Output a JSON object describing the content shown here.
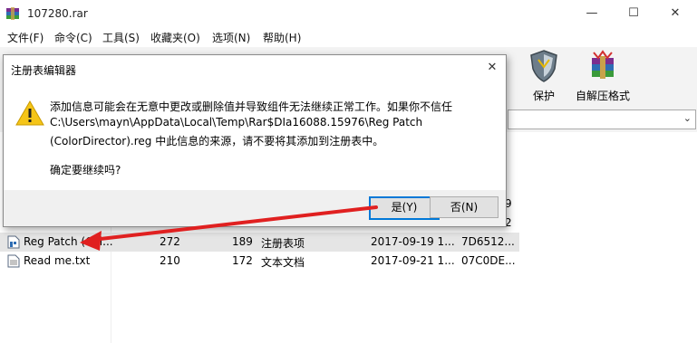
{
  "window": {
    "title": "107280.rar",
    "minimize_glyph": "—",
    "maximize_glyph": "☐",
    "close_glyph": "✕"
  },
  "menu": [
    "文件(F)",
    "命令(C)",
    "工具(S)",
    "收藏夹(O)",
    "选项(N)",
    "帮助(H)"
  ],
  "toolbar": {
    "protect_label": "保护",
    "sfx_label": "自解压格式"
  },
  "path_bar": {
    "chevron": "⌄"
  },
  "dialog": {
    "title": "注册表编辑器",
    "line1": "添加信息可能会在无意中更改或删除值并导致组件无法继续正常工作。如果你不信任",
    "line2": "C:\\Users\\mayn\\AppData\\Local\\Temp\\Rar$DIa16088.15976\\Reg Patch",
    "line3": "(ColorDirector).reg 中此信息的来源，请不要将其添加到注册表中。",
    "question": "确定要继续吗?",
    "yes_label": "是(Y)",
    "no_label": "否(N)",
    "close_glyph": "✕",
    "icon": "warning-icon"
  },
  "files": [
    {
      "name": "Reg Patch (Col...",
      "size": "272",
      "packed": "189",
      "type": "注册表项",
      "modified": "2017-09-19 1...",
      "crc": "7D6512..."
    },
    {
      "name": "Read me.txt",
      "size": "210",
      "packed": "172",
      "type": "文本文档",
      "modified": "2017-09-21 1...",
      "crc": "07C0DE..."
    }
  ],
  "partial_rows": [
    "9",
    "2"
  ],
  "colors": {
    "accent": "#0078d7",
    "arrow": "#e02020",
    "warning": "#f5c518"
  }
}
